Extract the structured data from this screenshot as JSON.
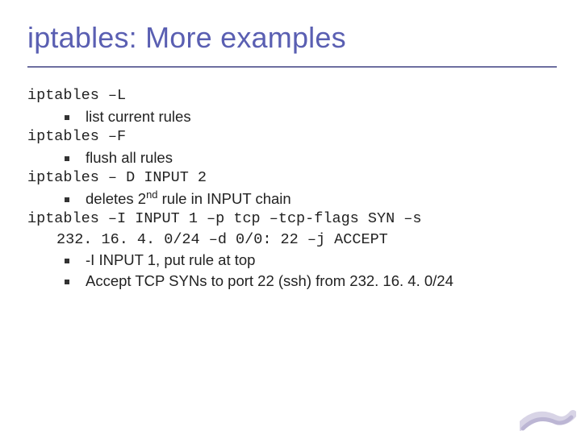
{
  "title": "iptables: More examples",
  "cmd1": "iptables –L",
  "b1": "list current rules",
  "cmd2": "iptables –F",
  "b2": "flush all rules",
  "cmd3": "iptables – D INPUT 2",
  "b3_pre": "deletes 2",
  "b3_sup": "nd",
  "b3_post": " rule in INPUT chain",
  "cmd4_l1": "iptables –I INPUT 1 –p tcp –tcp-flags SYN –s",
  "cmd4_l2": "232. 16. 4. 0/24 –d 0/0: 22 –j ACCEPT",
  "b4": "-I INPUT 1, put rule at top",
  "b5": "Accept TCP SYNs to port 22 (ssh) from 232. 16. 4. 0/24"
}
